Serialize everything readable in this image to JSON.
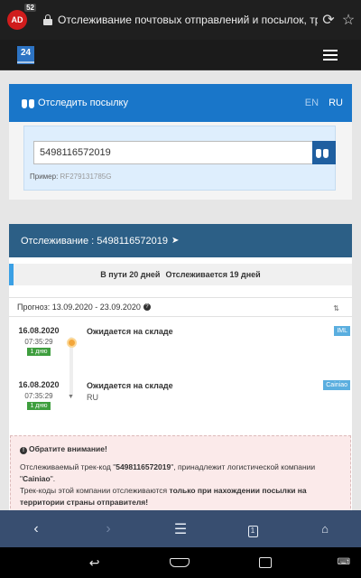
{
  "browser": {
    "notification_count": "52",
    "url_text": "Отслеживание почтовых отправлений и посылок, трекинг"
  },
  "site": {
    "logo_text": "24"
  },
  "track_card": {
    "title": "Отследить посылку",
    "lang_en": "EN",
    "lang_ru": "RU",
    "input_value": "5498116572019",
    "example_label": "Пример:",
    "example_code": "RF279131785G"
  },
  "result_card": {
    "header": "Отслеживание : 5498116572019",
    "in_transit": "В пути 20 дней",
    "tracked": "Отслеживается 19 дней",
    "progress_fraction": 0.012,
    "forecast": "Прогноз: 13.09.2020 - 23.09.2020",
    "events": [
      {
        "date": "16.08.2020",
        "time": "07:35:29",
        "days": "1 дню",
        "status": "Ожидается на складе",
        "location": "",
        "carrier": "IML"
      },
      {
        "date": "16.08.2020",
        "time": "07:35:29",
        "days": "1 дню",
        "status": "Ожидается на складе",
        "location": "RU",
        "carrier": "Cainiao"
      }
    ],
    "notice": {
      "title": "Обратите внимание!",
      "line1_a": "Отслеживаемый трек-код \"",
      "line1_code": "5498116572019",
      "line1_b": "\", принадлежит логистической компании \"",
      "line1_company": "Cainiao",
      "line1_c": "\".",
      "line2_a": "Трек-коды этой компании отслеживаются ",
      "line2_bold": "только при нахождении посылки на территории страны отправителя!"
    }
  },
  "colors": {
    "track_header": "#1976c9",
    "result_header": "#2c5f86",
    "browser_nav": "#384e70"
  },
  "icons": {
    "adblock": "adblock-icon",
    "lock": "lock-icon",
    "reload": "reload-icon",
    "star": "star-icon",
    "menu": "hamburger-menu-icon",
    "binoculars": "binoculars-icon",
    "plane": "paper-plane-icon",
    "info": "info-icon",
    "sort": "sort-icon",
    "warning": "exclamation-icon",
    "back": "back-icon",
    "forward": "forward-icon",
    "menu_bottom": "menu-icon",
    "tabs": "tabs-icon",
    "home": "home-icon"
  }
}
